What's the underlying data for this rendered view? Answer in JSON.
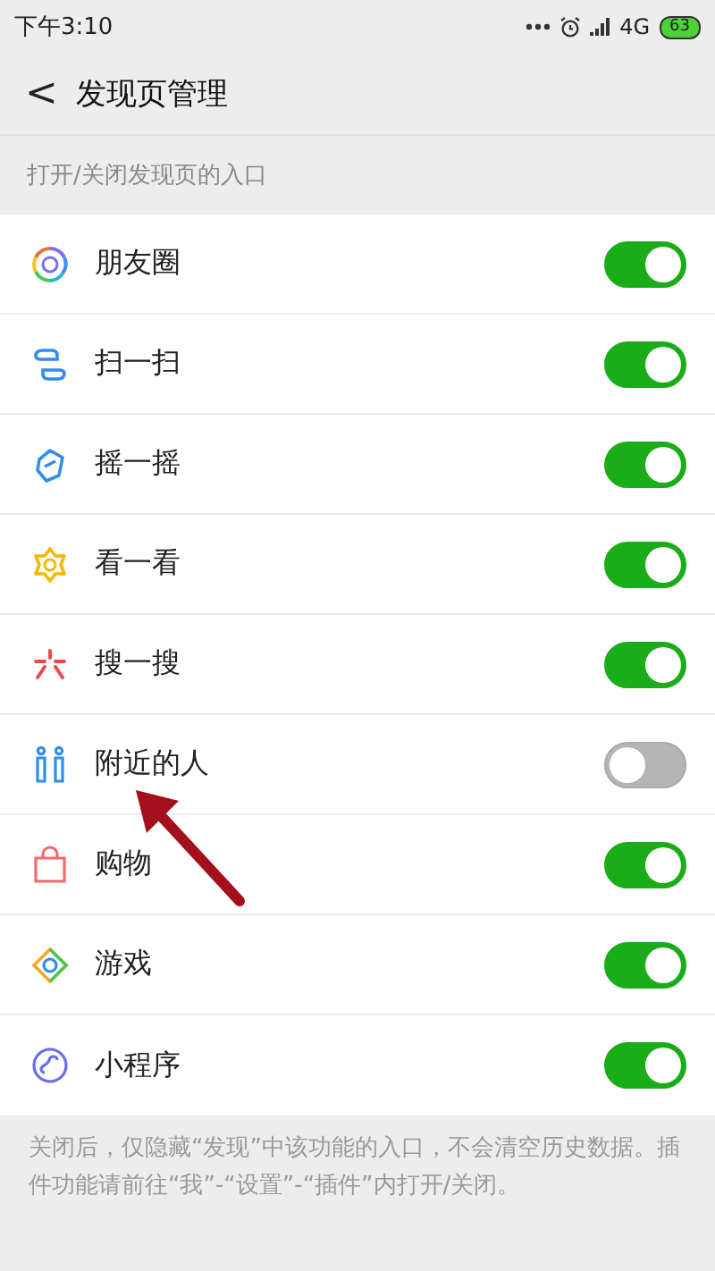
{
  "status_bar": {
    "time": "下午3:10",
    "network": "4G",
    "battery": "63"
  },
  "header": {
    "back": "<",
    "title": "发现页管理"
  },
  "section_label": "打开/关闭发现页的入口",
  "entries": [
    {
      "kind": "moments",
      "label": "朋友圈",
      "on": true
    },
    {
      "kind": "scan",
      "label": "扫一扫",
      "on": true
    },
    {
      "kind": "shake",
      "label": "摇一摇",
      "on": true
    },
    {
      "kind": "look",
      "label": "看一看",
      "on": true
    },
    {
      "kind": "search",
      "label": "搜一搜",
      "on": true
    },
    {
      "kind": "nearby",
      "label": "附近的人",
      "on": false
    },
    {
      "kind": "shop",
      "label": "购物",
      "on": true
    },
    {
      "kind": "game",
      "label": "游戏",
      "on": true
    },
    {
      "kind": "miniapp",
      "label": "小程序",
      "on": true
    }
  ],
  "footer_note": "关闭后，仅隐藏“发现”中该功能的入口，不会清空历史数据。插件功能请前往“我”-“设置”-“插件”内打开/关闭。"
}
